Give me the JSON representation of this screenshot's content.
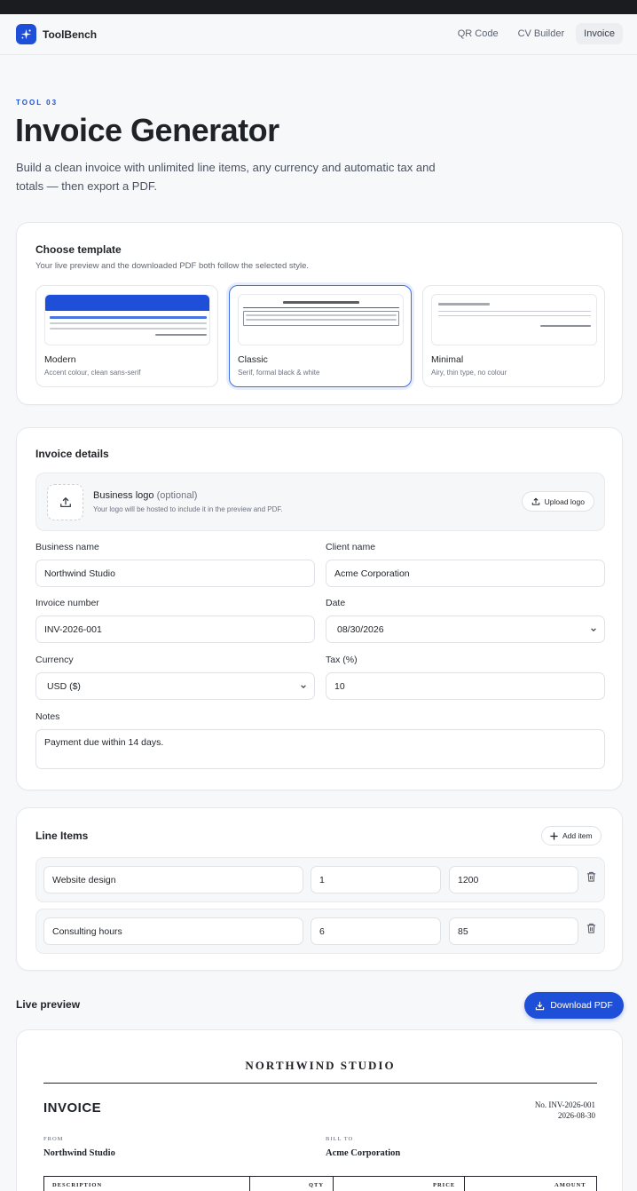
{
  "brand": {
    "name": "ToolBench"
  },
  "nav": {
    "links": [
      "QR Code",
      "CV Builder",
      "Invoice"
    ],
    "active": "Invoice"
  },
  "hero": {
    "eyebrow": "TOOL 03",
    "title": "Invoice Generator",
    "description": "Build a clean invoice with unlimited line items, any currency and automatic tax and totals — then export a PDF."
  },
  "templates": {
    "title": "Choose template",
    "subtitle": "Your live preview and the downloaded PDF both follow the selected style.",
    "selected": "Classic",
    "items": [
      {
        "name": "Modern",
        "desc": "Accent colour, clean sans-serif"
      },
      {
        "name": "Classic",
        "desc": "Serif, formal black & white"
      },
      {
        "name": "Minimal",
        "desc": "Airy, thin type, no colour"
      }
    ]
  },
  "details": {
    "title": "Invoice details",
    "logo": {
      "label": "Business logo",
      "optional": "(optional)",
      "hint": "Your logo will be hosted to include it in the preview and PDF.",
      "upload_label": "Upload logo"
    },
    "business_name": {
      "label": "Business name",
      "value": "Northwind Studio"
    },
    "client_name": {
      "label": "Client name",
      "value": "Acme Corporation"
    },
    "invoice_number": {
      "label": "Invoice number",
      "value": "INV-2026-001"
    },
    "date": {
      "label": "Date",
      "value": "08/30/2026"
    },
    "currency": {
      "label": "Currency",
      "value": "USD ($)"
    },
    "tax": {
      "label": "Tax (%)",
      "value": "10"
    },
    "notes": {
      "label": "Notes",
      "value": "Payment due within 14 days."
    }
  },
  "line_items": {
    "title": "Line Items",
    "add_label": "Add item",
    "items": [
      {
        "description": "Website design",
        "qty": "1",
        "price": "1200"
      },
      {
        "description": "Consulting hours",
        "qty": "6",
        "price": "85"
      }
    ]
  },
  "preview": {
    "title": "Live preview",
    "download_label": "Download PDF",
    "doc": {
      "business_heading": "NORTHWIND STUDIO",
      "heading": "INVOICE",
      "number": "No. INV-2026-001",
      "date": "2026-08-30",
      "from_label": "FROM",
      "from_name": "Northwind Studio",
      "bill_to_label": "BILL TO",
      "bill_to_name": "Acme Corporation",
      "columns": [
        "DESCRIPTION",
        "QTY",
        "PRICE",
        "AMOUNT"
      ]
    }
  },
  "colors": {
    "accent": "#1e4fd8",
    "selected_border": "#3d6ee8",
    "modern_header": "#1e4fd8"
  }
}
